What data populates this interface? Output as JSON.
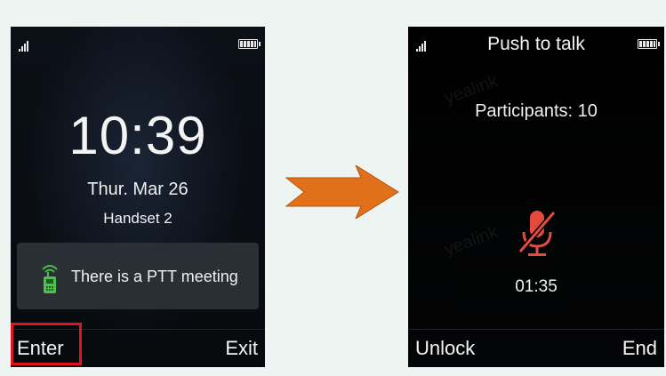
{
  "left_screen": {
    "time": "10:39",
    "date": "Thur. Mar 26",
    "handset": "Handset 2",
    "notification": "There is a PTT meeting",
    "softkeys": {
      "left": "Enter",
      "right": "Exit"
    }
  },
  "right_screen": {
    "title": "Push to talk",
    "participants": "Participants: 10",
    "timer": "01:35",
    "softkeys": {
      "left": "Unlock",
      "right": "End"
    }
  },
  "colors": {
    "arrow": "#e0701a",
    "highlight_box": "#e0141e",
    "muted_mic": "#e54a3f",
    "ptt_icon": "#4cc24a"
  },
  "icons": [
    "signal-icon",
    "battery-icon",
    "ptt-walkie-icon",
    "mic-muted-icon",
    "arrow-right-icon"
  ]
}
